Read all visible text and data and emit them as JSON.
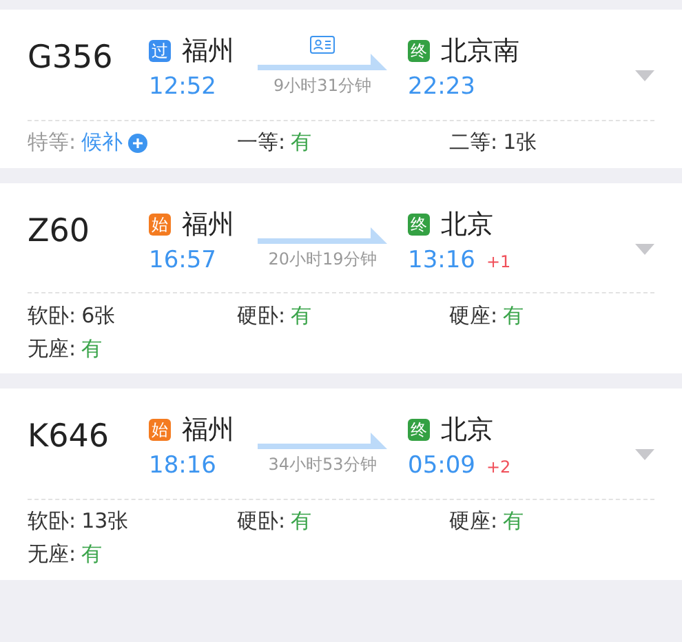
{
  "trains": [
    {
      "number": "G356",
      "from": {
        "badge": "过",
        "color": "#3b8ff0",
        "name": "福州",
        "time": "12:52"
      },
      "duration": "9小时31分钟",
      "id_card": true,
      "to": {
        "badge": "终",
        "color": "#34a143",
        "name": "北京南",
        "time": "22:23"
      },
      "seats": [
        {
          "label": "特等:",
          "value": "候补",
          "kind": "waitlist"
        },
        {
          "label": "一等:",
          "value": "有",
          "kind": "available"
        },
        {
          "label": "二等:",
          "value": "1张",
          "kind": "count"
        }
      ]
    },
    {
      "number": "Z60",
      "from": {
        "badge": "始",
        "color": "#f47b20",
        "name": "福州",
        "time": "16:57"
      },
      "duration": "20小时19分钟",
      "id_card": false,
      "to": {
        "badge": "终",
        "color": "#34a143",
        "name": "北京",
        "time": "13:16"
      },
      "day_offset": "+1",
      "seats": [
        {
          "label": "软卧:",
          "value": "6张",
          "kind": "count"
        },
        {
          "label": "硬卧:",
          "value": "有",
          "kind": "available"
        },
        {
          "label": "硬座:",
          "value": "有",
          "kind": "available"
        },
        {
          "label": "无座:",
          "value": "有",
          "kind": "available"
        }
      ]
    },
    {
      "number": "K646",
      "from": {
        "badge": "始",
        "color": "#f47b20",
        "name": "福州",
        "time": "18:16"
      },
      "duration": "34小时53分钟",
      "id_card": false,
      "to": {
        "badge": "终",
        "color": "#34a143",
        "name": "北京",
        "time": "05:09"
      },
      "day_offset": "+2",
      "seats": [
        {
          "label": "软卧:",
          "value": "13张",
          "kind": "count"
        },
        {
          "label": "硬卧:",
          "value": "有",
          "kind": "available"
        },
        {
          "label": "硬座:",
          "value": "有",
          "kind": "available"
        },
        {
          "label": "无座:",
          "value": "有",
          "kind": "available"
        }
      ]
    }
  ]
}
